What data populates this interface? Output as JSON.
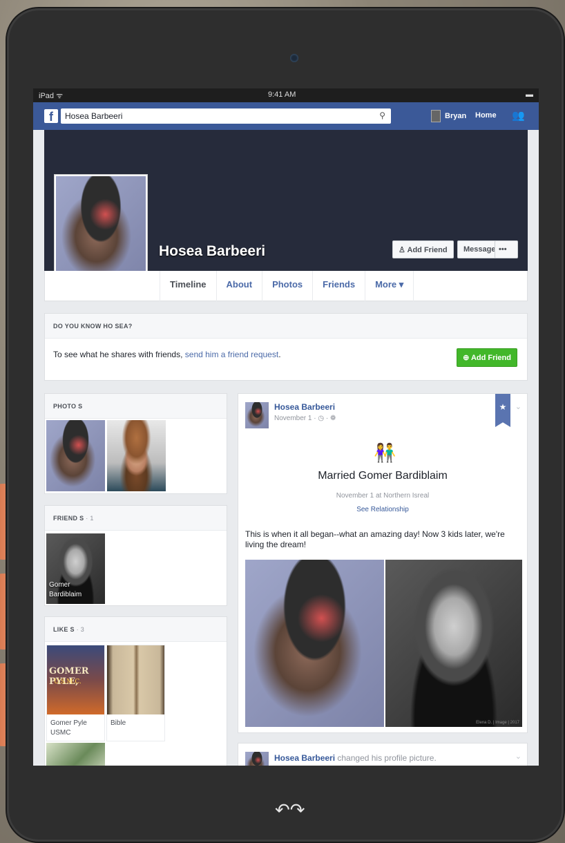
{
  "statusbar": {
    "carrier": "iPad ᯤ",
    "time": "9:41 AM",
    "battery": "▬"
  },
  "topbar": {
    "logo": "f",
    "search_value": "Hosea Barbeeri",
    "user_name": "Bryan",
    "home_label": "Home"
  },
  "profile": {
    "name": "Hosea Barbeeri",
    "add_friend": "Add Friend",
    "message": "Message",
    "more_dots": "•••",
    "tabs": [
      "Timeline",
      "About",
      "Photos",
      "Friends",
      "More ▾"
    ]
  },
  "dyk": {
    "title": "DO YOU KNOW HO SEA?",
    "text_before": "To see what he shares with friends, ",
    "link": "send him a friend request",
    "text_after": ".",
    "button": "Add Friend"
  },
  "photos_card": {
    "title": "PHOTO S"
  },
  "friends_card": {
    "title": "FRIEND S",
    "count": "· 1",
    "friend_name": "Gomer Bardiblaim"
  },
  "likes_card": {
    "title": "LIKE S",
    "count": "· 3",
    "items": [
      {
        "label": "Gomer Pyle USMC",
        "image_text": "GOMER PYLE,",
        "image_sub": "U.S.M.C."
      },
      {
        "label": "Bible"
      }
    ]
  },
  "post": {
    "author": "Hosea Barbeeri",
    "date": "November 1 · ◷ · ❁",
    "event_title": "Married Gomer Bardiblaim",
    "event_sub": "November 1 at Northern Isreal",
    "see_relationship": "See Relationship",
    "text": "This is when it all began--what an amazing day! Now 3 kids later, we're living the dream!",
    "photo_watermark": "Elena D. | Image | 2017"
  },
  "post2": {
    "author": "Hosea Barbeeri",
    "action": " changed his profile picture."
  },
  "colors": {
    "fb_blue": "#3b5998",
    "cover": "#262b3b",
    "green": "#42b72a"
  }
}
